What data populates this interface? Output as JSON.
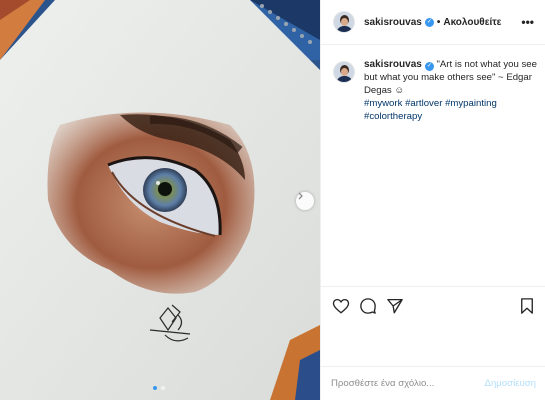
{
  "post": {
    "username": "sakisrouvas",
    "separator": "•",
    "follow_label": "Ακολουθείτε",
    "more_label": "•••"
  },
  "caption": {
    "username": "sakisrouvas",
    "quote": "\"Art is not what you see but what you make others see\" ~ Edgar Degas ☺",
    "hashtags": [
      "#mywork",
      "#artlover",
      "#mypainting",
      "#colortherapy"
    ]
  },
  "actions": {
    "icons": [
      "heart-icon",
      "comment-icon",
      "share-icon",
      "bookmark-icon"
    ]
  },
  "comment": {
    "placeholder": "Προσθέστε ένα σχόλιο...",
    "post_label": "Δημοσίευση"
  },
  "carousel": {
    "total": 2,
    "current": 1
  },
  "colors": {
    "accent": "#3897f0",
    "post_disabled": "#b2dffc",
    "hashtag": "#003569"
  }
}
